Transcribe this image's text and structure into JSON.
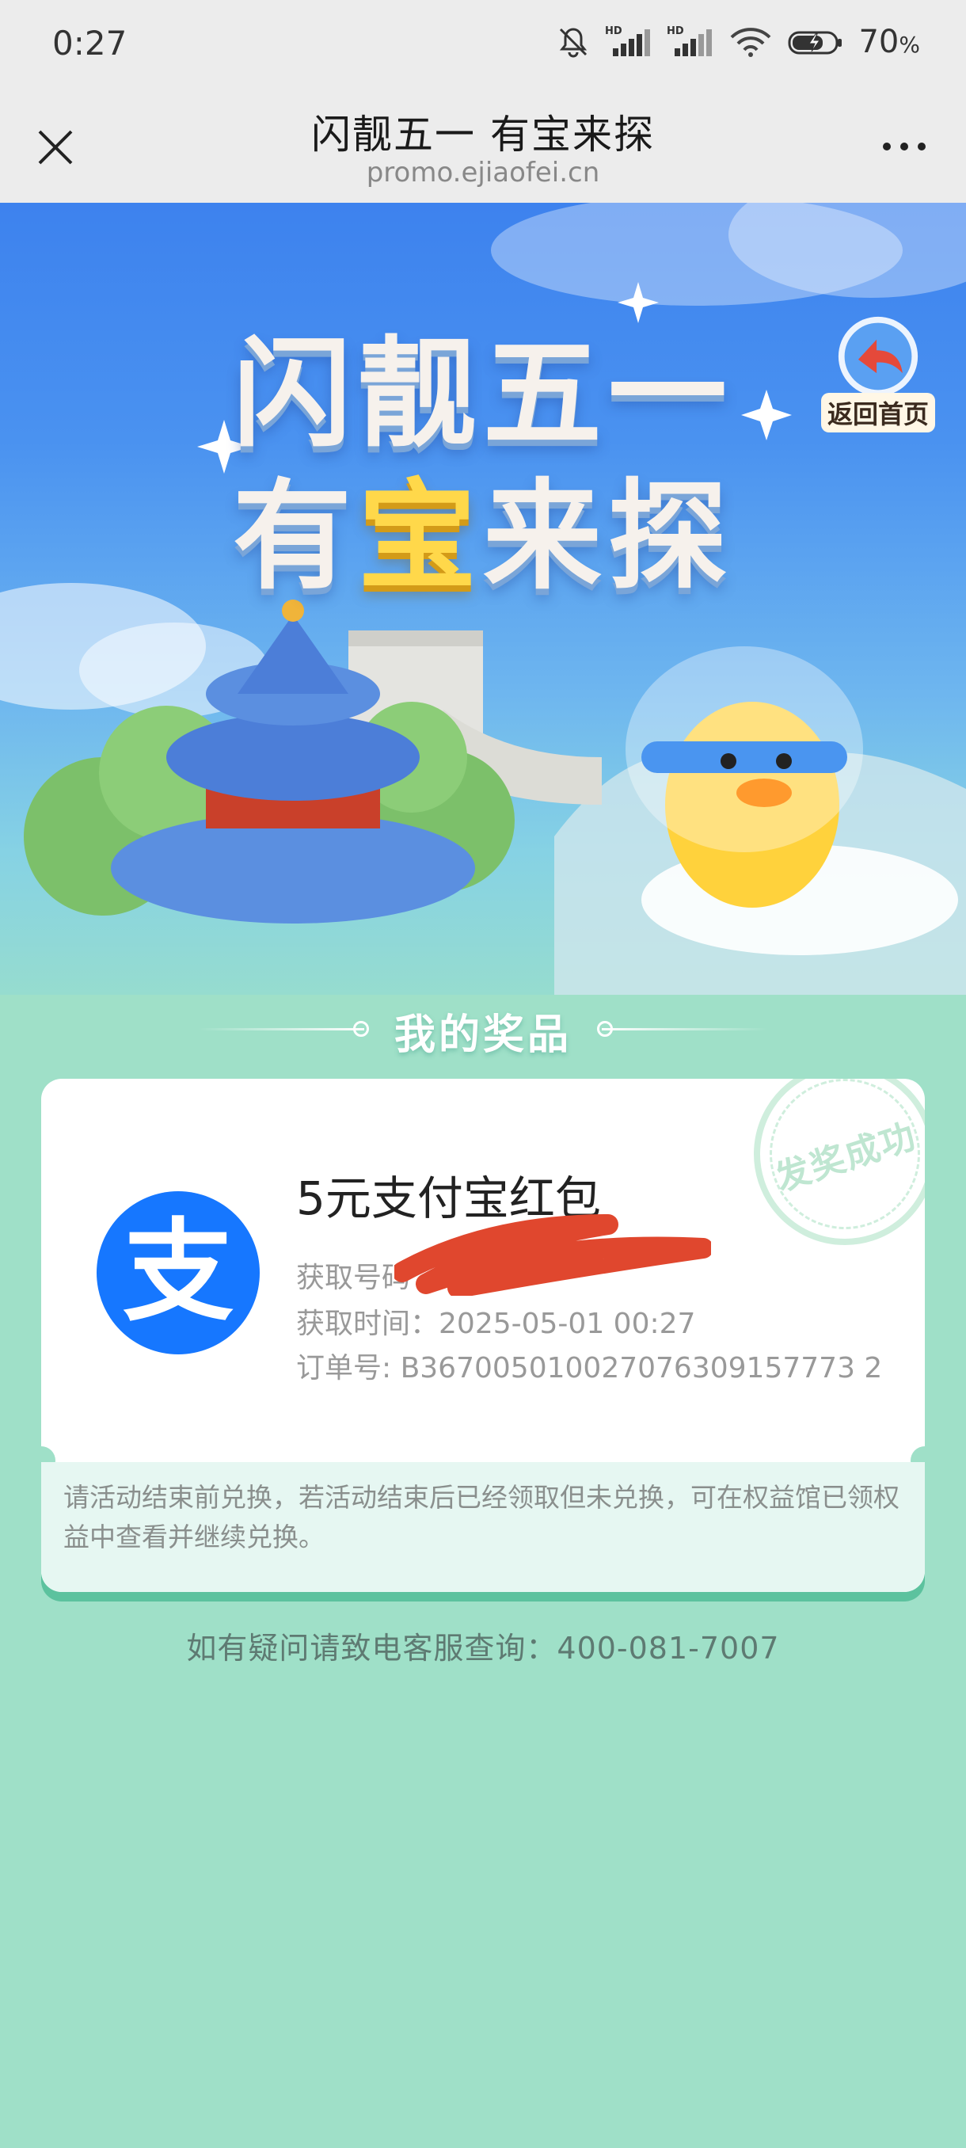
{
  "status_bar": {
    "time": "0:27",
    "signal_labels": [
      "HD",
      "HD"
    ],
    "battery_percent": "70",
    "battery_unit": "%",
    "icons": [
      "mute-icon",
      "signal-icon",
      "signal-icon",
      "wifi-icon",
      "battery-charging-icon"
    ]
  },
  "nav": {
    "title": "闪靓五一 有宝来探",
    "url": "promo.ejiaofei.cn",
    "close_icon": "close-icon",
    "more_icon": "more-icon"
  },
  "hero": {
    "title_line1": "闪靓五一",
    "title_line2_before": "有",
    "title_line2_gold": "宝",
    "title_line2_after": "来探",
    "back_home_label": "返回首页"
  },
  "section": {
    "title": "我的奖品"
  },
  "prize": {
    "logo_char": "支",
    "name": "5元支付宝红包",
    "code_label": "获取号码",
    "time_label": "获取时间：",
    "time_value": "2025-05-01 00:27",
    "order_label": "订单号: ",
    "order_value": "B367005010027076309157773 2",
    "stamp_text": "发奖成功",
    "notice": "请活动结束前兑换，若活动结束后已经领取但未兑换，可在权益馆已领权益中查看并继续兑换。"
  },
  "footer": {
    "hotline": "如有疑问请致电客服查询：400-081-7007"
  },
  "colors": {
    "page_bg": "#9fe0c8",
    "hero_blue": "#3d82ee",
    "alipay_blue": "#1677ff",
    "redaction_red": "#e0472e",
    "card_shadow": "#5cc29e"
  }
}
